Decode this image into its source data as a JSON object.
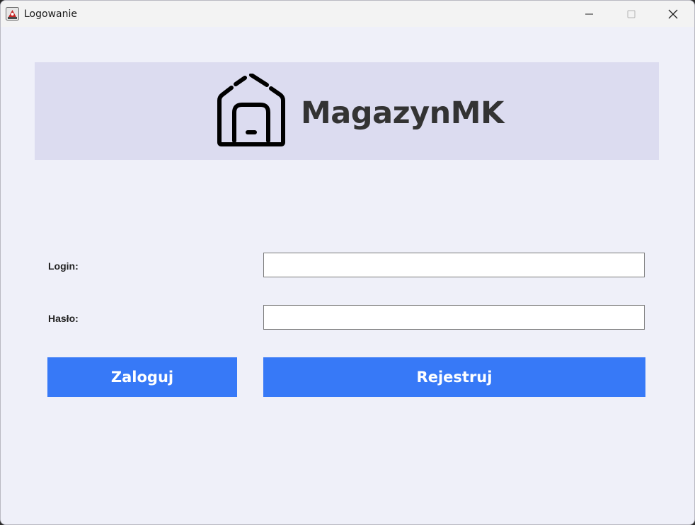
{
  "window": {
    "title": "Logowanie",
    "app_icon": "java-app-icon",
    "controls": [
      "minimize-icon",
      "maximize-icon",
      "close-icon"
    ]
  },
  "banner": {
    "logo_icon": "warehouse-house-icon",
    "brand": "MagazynMK"
  },
  "form": {
    "login_label": "Login:",
    "login_value": "",
    "password_label": "Hasło:",
    "password_value": ""
  },
  "buttons": {
    "login": "Zaloguj",
    "register": "Rejestruj"
  },
  "colors": {
    "background": "#eff0f9",
    "banner": "#dcdcf0",
    "button": "#3779f7",
    "button_text": "#ffffff",
    "brand_text": "#333333"
  }
}
